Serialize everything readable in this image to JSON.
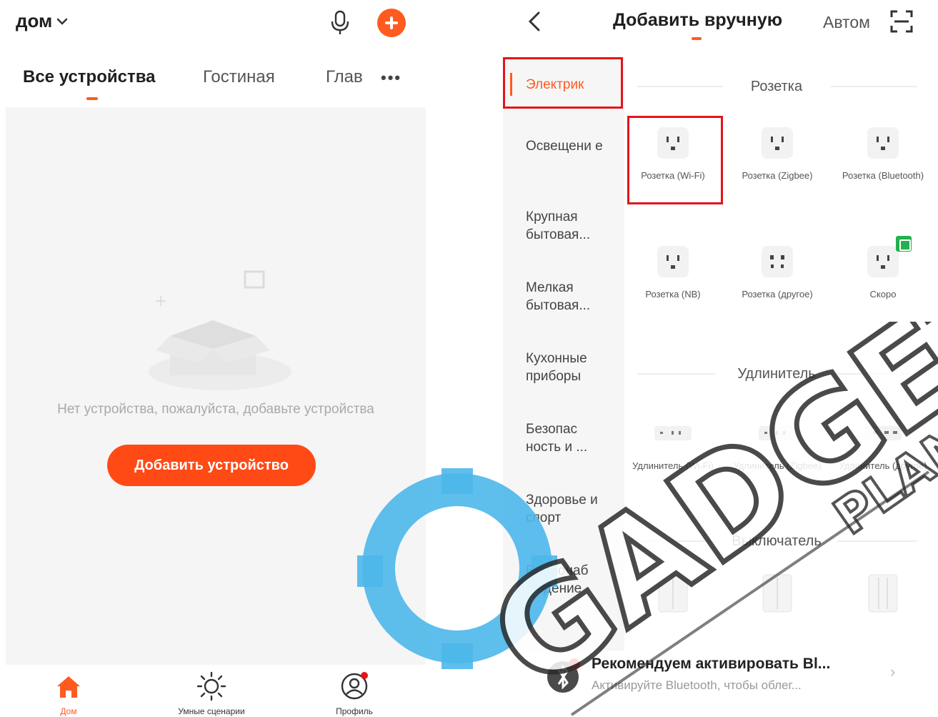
{
  "left": {
    "home_title": "дом",
    "tabs": [
      {
        "label": "Все устройства",
        "active": true
      },
      {
        "label": "Гостиная",
        "active": false
      },
      {
        "label": "Глав",
        "active": false
      }
    ],
    "tabs_more": "•••",
    "empty_text": "Нет устройства, пожалуйста, добавьте устройства",
    "add_button_label": "Добавить устройство",
    "bottom_nav": [
      {
        "label": "Дом",
        "icon": "home-icon",
        "active": true
      },
      {
        "label": "Умные сценарии",
        "icon": "sun-icon",
        "active": false
      },
      {
        "label": "Профиль",
        "icon": "profile-icon",
        "active": false
      }
    ]
  },
  "right": {
    "title": "Добавить вручную",
    "auto_tab": "Автом",
    "categories": [
      {
        "label": "Электрик",
        "active": true
      },
      {
        "label": "Освещени е",
        "active": false
      },
      {
        "label": "Крупная бытовая...",
        "active": false
      },
      {
        "label": "Мелкая бытовая...",
        "active": false
      },
      {
        "label": "Кухонные приборы",
        "active": false
      },
      {
        "label": "Безопас ность и ...",
        "active": false
      },
      {
        "label": "Здоровье и спорт",
        "active": false
      },
      {
        "label": "Видеонаб людение",
        "active": false
      }
    ],
    "sections": [
      {
        "title": "Розетка",
        "devices": [
          {
            "name": "Розетка (Wi-Fi)",
            "highlighted": true
          },
          {
            "name": "Розетка (Zigbee)"
          },
          {
            "name": "Розетка (Bluetooth)"
          },
          {
            "name": "Розетка (NB)"
          },
          {
            "name": "Розетка (другое)"
          },
          {
            "name": "Скоро"
          }
        ]
      },
      {
        "title": "Удлинитель",
        "devices": [
          {
            "name": "Удлинитель (Wi-Fi)"
          },
          {
            "name": "Удлинитель (Zigbee)"
          },
          {
            "name": "Удлинитель (другое)"
          }
        ]
      },
      {
        "title": "Выключатель",
        "devices": []
      }
    ],
    "recommend": {
      "title": "Рекомендуем активировать Bl...",
      "subtitle": "Активируйте Bluetooth, чтобы облег..."
    }
  },
  "colors": {
    "accent": "#ff5b1f",
    "highlight_box": "#e4141b",
    "new_badge": "#23b14d"
  },
  "watermark": {
    "text": "GADGET",
    "subtext": "PLAN"
  }
}
